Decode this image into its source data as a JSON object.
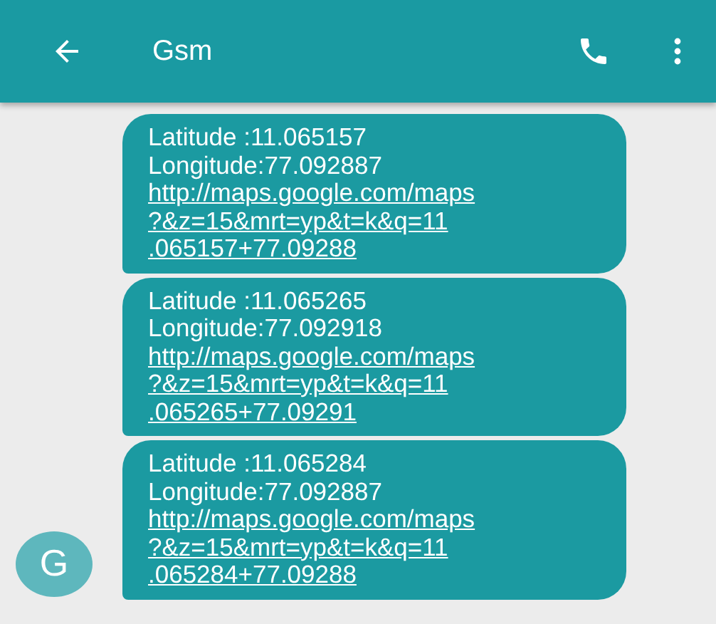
{
  "app_bar": {
    "title": "Gsm"
  },
  "messages": [
    {
      "lines": [
        "Latitude :11.065157",
        "Longitude:77.092887"
      ],
      "link_lines": [
        "http://maps.google.com/maps",
        "?&z=15&mrt=yp&t=k&q=11",
        ".065157+77.09288"
      ]
    },
    {
      "lines": [
        "Latitude :11.065265",
        "Longitude:77.092918"
      ],
      "link_lines": [
        "http://maps.google.com/maps",
        "?&z=15&mrt=yp&t=k&q=11",
        ".065265+77.09291"
      ]
    },
    {
      "lines": [
        "Latitude :11.065284",
        "Longitude:77.092887"
      ],
      "link_lines": [
        "http://maps.google.com/maps",
        "?&z=15&mrt=yp&t=k&q=11",
        ".065284+77.09288"
      ],
      "avatar": "G"
    }
  ]
}
